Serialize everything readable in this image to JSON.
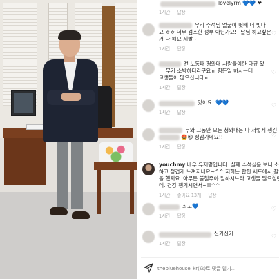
{
  "photo": {
    "alt_name": "office-portrait-photo"
  },
  "comments": [
    {
      "avatar": "blurred",
      "username_visible": "",
      "lines": [
        "lovelyrm 💙💙 ❤"
      ],
      "meta": [
        "1시간",
        "답장"
      ]
    },
    {
      "avatar": "blurred",
      "username_visible": "",
      "lines": [
        "우리 수석님 얼굴이 몇배 더 빛나",
        "요 ㅎㅎ 너무 검소한 정부 아닌가요!! 달님 하고싶은",
        "거 다 해요 제발~"
      ],
      "meta": [
        "1시간",
        "답장"
      ]
    },
    {
      "avatar": "blurred",
      "username_visible": "",
      "lines": [
        "전 노동때 청와대 사람들이란 다큐 봤",
        "무가 소박하더라구요ㅠ 힘든일 하시는데",
        "고생들이 많으십니다ㅠ"
      ],
      "meta": [
        "1시간",
        "답장"
      ]
    },
    {
      "avatar": "blurred",
      "username_visible": "",
      "lines": [
        "있어요! 💙💙"
      ],
      "meta": [
        "1시간",
        "답장"
      ]
    },
    {
      "avatar": "blurred",
      "username_visible": "",
      "lines": [
        "우와 그동안 모든 청와대는 다 저렇게 생긴",
        "🤩😍 정감가네요!!"
      ],
      "meta": [
        "1시간",
        "답장"
      ]
    },
    {
      "avatar": "real",
      "username_visible": "youchmy",
      "lines": [
        "배우 유재명입니다. 실제 수석실을 보니 소박",
        "하고 정겹게 느껴지네요~^^ 저희는 합천 세트에서 촬영",
        "을 했지요. 아무튼 불철주야 일하시느라 고생들 많으실텐",
        "데. 건강 챙기시면서~!!^^"
      ],
      "meta": [
        "1시간",
        "좋아요 13개",
        "답장"
      ]
    },
    {
      "avatar": "blurred",
      "username_visible": "",
      "lines": [
        "최고💙"
      ],
      "meta": [
        "1시간",
        "답장"
      ]
    },
    {
      "avatar": "blurred",
      "username_visible": "",
      "lines": [
        "신기신기"
      ],
      "meta": [
        "1시간",
        "답장"
      ]
    }
  ],
  "reply_bar": {
    "placeholder": "thebluehouse_kr(으)로 댓글 달기..."
  },
  "colors": {
    "text": "#262626",
    "meta": "#a8a8a8",
    "heart_blue": "#3b86e5"
  }
}
